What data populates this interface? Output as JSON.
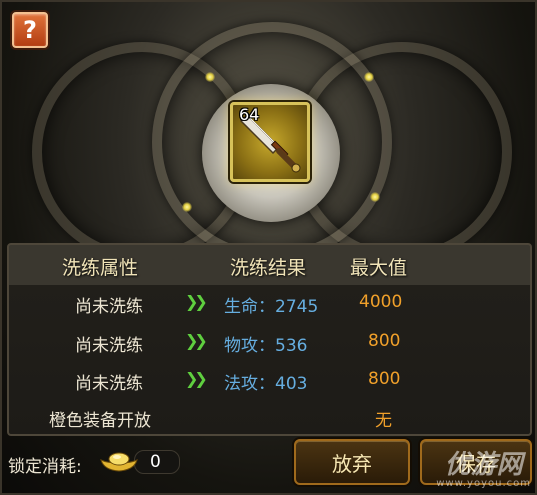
{
  "help_button": {
    "label": "?"
  },
  "item": {
    "level": "64",
    "icon": "dagger-icon"
  },
  "table": {
    "headers": {
      "attribute": "洗练属性",
      "result": "洗练结果",
      "max": "最大值"
    },
    "rows": [
      {
        "attribute": "尚未洗练",
        "result": "生命：2745",
        "max": "4000"
      },
      {
        "attribute": "尚未洗练",
        "result": "物攻：536",
        "max": "800"
      },
      {
        "attribute": "尚未洗练",
        "result": "法攻：403",
        "max": "800"
      },
      {
        "attribute": "橙色装备开放",
        "result": "",
        "max": "无"
      }
    ]
  },
  "lock_cost": {
    "label": "锁定消耗:",
    "value": "0",
    "icon": "gold-ingot-icon"
  },
  "buttons": {
    "abandon": "放弃",
    "save": "保存"
  },
  "watermark": {
    "main": "优游网",
    "sub": "www.yoyou.com"
  },
  "colors": {
    "attribute_text": "#ece5d2",
    "result_text": "#66aee0",
    "max_text": "#f0a02a",
    "arrow": "#5fcf3f",
    "item_frame": "#d7c25a"
  }
}
